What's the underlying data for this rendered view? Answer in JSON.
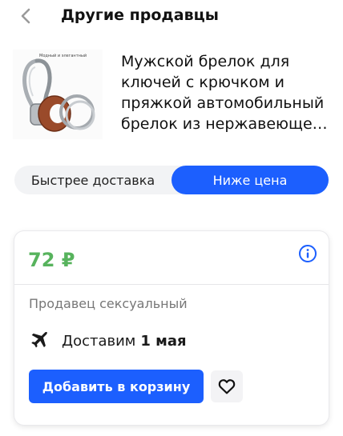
{
  "header": {
    "title": "Другие продавцы",
    "back_icon": "chevron-left-icon"
  },
  "product": {
    "image_caption": "Модный и элегантный",
    "name": "Мужской брелок для ключей с крючком и пряжкой автомобильный брелок из нержавеющей стали"
  },
  "filters": {
    "tabs": [
      {
        "label": "Быстрее доставка",
        "active": false
      },
      {
        "label": "Ниже цена",
        "active": true
      }
    ],
    "active_color": "#1c5ffe"
  },
  "offer": {
    "price": "72 ₽",
    "price_color": "#57b35d",
    "info_icon": "info-icon",
    "seller": "Продавец сексуальный",
    "delivery_icon": "airplane-icon",
    "delivery_prefix": "Доставим",
    "delivery_date": "1 мая",
    "add_to_cart_label": "Добавить в корзину",
    "favorite_icon": "heart-icon"
  }
}
